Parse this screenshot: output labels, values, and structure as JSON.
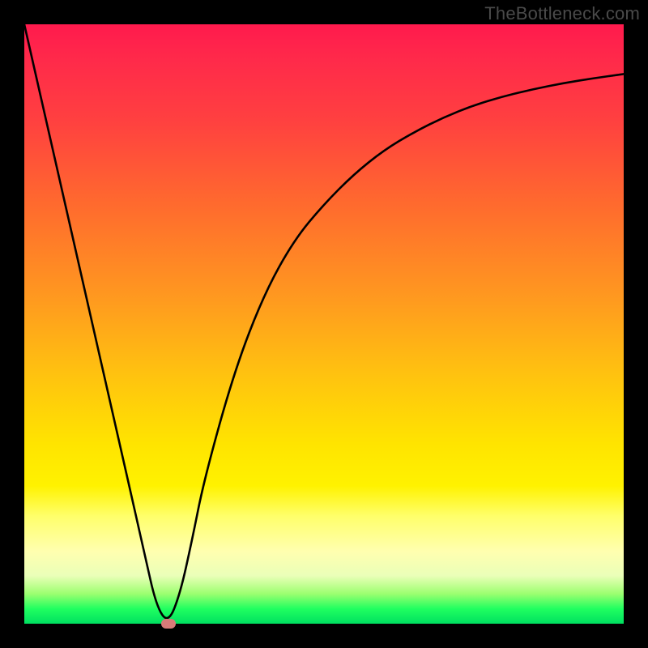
{
  "attribution": "TheBottleneck.com",
  "chart_data": {
    "type": "line",
    "title": "",
    "xlabel": "",
    "ylabel": "",
    "xlim": [
      0,
      100
    ],
    "ylim": [
      0,
      100
    ],
    "legend": false,
    "grid": false,
    "background": "red-orange-yellow-green vertical gradient",
    "series": [
      {
        "name": "bottleneck-curve",
        "x": [
          0,
          5,
          10,
          15,
          20,
          22,
          24,
          26,
          28,
          30,
          35,
          40,
          45,
          50,
          55,
          60,
          65,
          70,
          75,
          80,
          85,
          90,
          95,
          100
        ],
        "values": [
          100,
          78,
          56,
          34,
          12,
          3,
          0,
          5,
          14,
          24,
          42,
          55,
          64,
          70,
          75,
          79,
          82,
          84.5,
          86.5,
          88,
          89.2,
          90.2,
          91,
          91.7
        ]
      }
    ],
    "marker": {
      "x": 24,
      "y": 0,
      "label": "optimal-point"
    },
    "annotations": []
  }
}
